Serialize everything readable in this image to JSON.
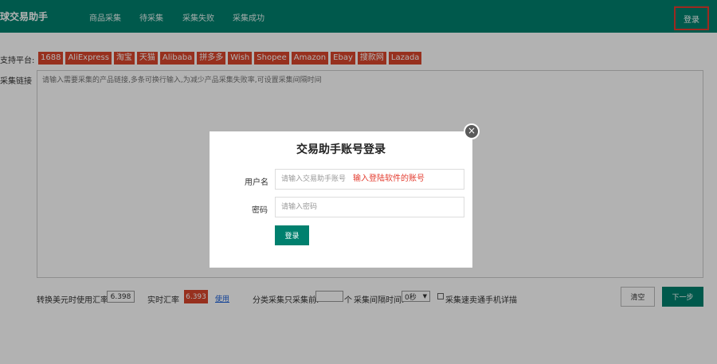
{
  "header": {
    "brand": "球交易助手",
    "nav": [
      "商品采集",
      "待采集",
      "采集失败",
      "采集成功"
    ],
    "login_label": "登录"
  },
  "platforms": {
    "label": "支持平台:",
    "items": [
      "1688",
      "AliExpress",
      "淘宝",
      "天猫",
      "Alibaba",
      "拼多多",
      "Wish",
      "Shopee",
      "Amazon",
      "Ebay",
      "搜款网",
      "Lazada"
    ]
  },
  "links": {
    "label": "采集链接",
    "placeholder": "请输入需要采集的产品链接,多条可换行输入,为减少产品采集失败率,可设置采集间隔时间"
  },
  "bottom": {
    "usd_rate_label": "转换美元时使用汇率:",
    "usd_rate_value": "6.398",
    "live_rate_label": "实时汇率",
    "live_rate_value": "6.393",
    "use_link": "使用",
    "category_label": "分类采集只采集前:",
    "category_unit": "个",
    "interval_label": "采集间隔时间:",
    "interval_value": "0秒",
    "detail_label": "采集速卖通手机详描",
    "clear_button": "清空",
    "next_button": "下一步"
  },
  "modal": {
    "title": "交易助手账号登录",
    "username_label": "用户名",
    "username_placeholder": "请输入交易助手账号",
    "username_note": "输入登陆软件的账号",
    "password_label": "密码",
    "password_placeholder": "请输入密码",
    "login_button": "登录",
    "close_glyph": "×"
  },
  "colors": {
    "header": "#00806e",
    "platform_tag": "#d9462b",
    "highlight_border": "#e33b2e",
    "link": "#1a5fd8"
  }
}
